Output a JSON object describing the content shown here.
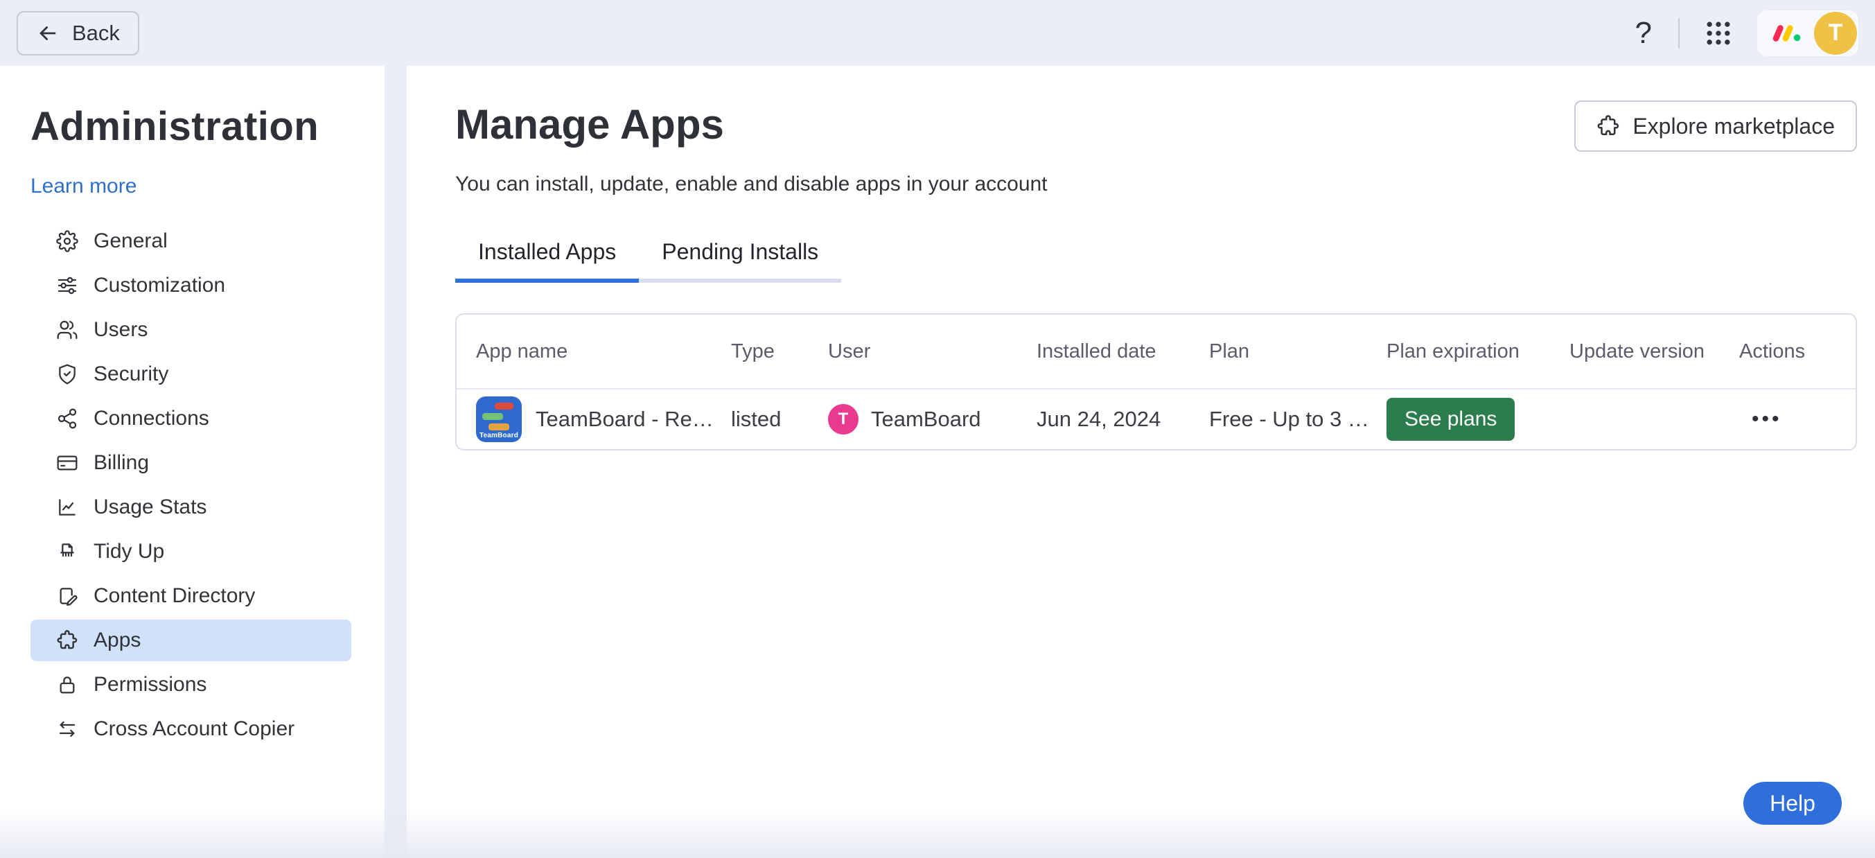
{
  "topbar": {
    "back_label": "Back",
    "question_glyph": "?",
    "avatar_initial": "T"
  },
  "sidebar": {
    "title": "Administration",
    "learn_more": "Learn more",
    "items": [
      {
        "label": "General",
        "icon": "gear-icon",
        "selected": false
      },
      {
        "label": "Customization",
        "icon": "sliders-icon",
        "selected": false
      },
      {
        "label": "Users",
        "icon": "users-icon",
        "selected": false
      },
      {
        "label": "Security",
        "icon": "shield-check-icon",
        "selected": false
      },
      {
        "label": "Connections",
        "icon": "network-icon",
        "selected": false
      },
      {
        "label": "Billing",
        "icon": "credit-card-icon",
        "selected": false
      },
      {
        "label": "Usage Stats",
        "icon": "chart-icon",
        "selected": false
      },
      {
        "label": "Tidy Up",
        "icon": "shredder-icon",
        "selected": false
      },
      {
        "label": "Content Directory",
        "icon": "document-edit-icon",
        "selected": false
      },
      {
        "label": "Apps",
        "icon": "puzzle-icon",
        "selected": true
      },
      {
        "label": "Permissions",
        "icon": "lock-icon",
        "selected": false
      },
      {
        "label": "Cross Account Copier",
        "icon": "swap-arrows-icon",
        "selected": false
      }
    ]
  },
  "main": {
    "title": "Manage Apps",
    "subtitle": "You can install, update, enable and disable apps in your account",
    "explore_button": "Explore marketplace",
    "tabs": [
      {
        "label": "Installed Apps",
        "active": true
      },
      {
        "label": "Pending Installs",
        "active": false
      }
    ],
    "table": {
      "columns": [
        "App name",
        "Type",
        "User",
        "Installed date",
        "Plan",
        "Plan expiration",
        "Update version",
        "Actions"
      ],
      "rows": [
        {
          "app_name": "TeamBoard - Re…",
          "app_icon_label": "TeamBoard",
          "type": "listed",
          "user": "TeamBoard",
          "user_initial": "T",
          "installed_date": "Jun 24, 2024",
          "plan": "Free - Up to 3 …",
          "plan_expiration_button": "See plans",
          "update_version": "",
          "actions": "•••"
        }
      ]
    }
  },
  "help_button": "Help",
  "colors": {
    "primary_blue": "#2e6fdb",
    "selected_item_bg": "#d0e2fa",
    "positive_green": "#2b7d4e",
    "avatar_yellow": "#efc245",
    "user_avatar_pink": "#e93a90",
    "topbar_bg": "#ebedf7",
    "app_icon_blue": "#2e6ace",
    "logo_red": "#f62b54",
    "logo_yellow": "#ffcb00",
    "logo_green": "#00ca72"
  }
}
